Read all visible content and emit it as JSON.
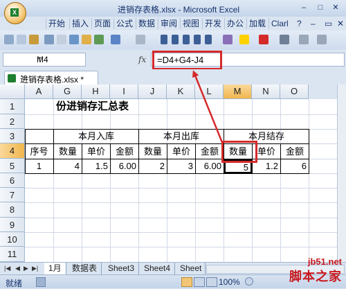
{
  "window": {
    "title": "进销存表格.xlsx - Microsoft Excel"
  },
  "menu": [
    "开始",
    "插入",
    "页面",
    "公式",
    "数据",
    "审阅",
    "视图",
    "开发",
    "办公",
    "加载",
    "Clarl"
  ],
  "name_box": "M4",
  "formula": "=D4+G4-J4",
  "document_tab": "进销存表格.xlsx *",
  "columns": [
    "A",
    "G",
    "H",
    "I",
    "J",
    "K",
    "L",
    "M",
    "N",
    "O"
  ],
  "rows": [
    "1",
    "2",
    "3",
    "4",
    "5",
    "6",
    "7",
    "8",
    "9",
    "10",
    "11"
  ],
  "sheet": {
    "title": "份进销存汇总表",
    "groups": [
      "本月入库",
      "本月出库",
      "本月结存"
    ],
    "headers": [
      "序号",
      "数量",
      "单价",
      "金额",
      "数量",
      "单价",
      "金额",
      "数量",
      "单价",
      "金额"
    ],
    "row4": [
      "1",
      "4",
      "1.5",
      "6.00",
      "2",
      "3",
      "6.00",
      "5",
      "1.2",
      "6"
    ]
  },
  "sheet_tabs": [
    "1月",
    "数据表",
    "Sheet3",
    "Sheet4",
    "Sheet"
  ],
  "status": {
    "ready": "就绪",
    "zoom": "100%"
  },
  "watermark": {
    "site": "jb51.net",
    "name": "脚本之家"
  },
  "colors": {
    "highlight": "#d42a2a",
    "selected_header": "#f1b64d"
  }
}
